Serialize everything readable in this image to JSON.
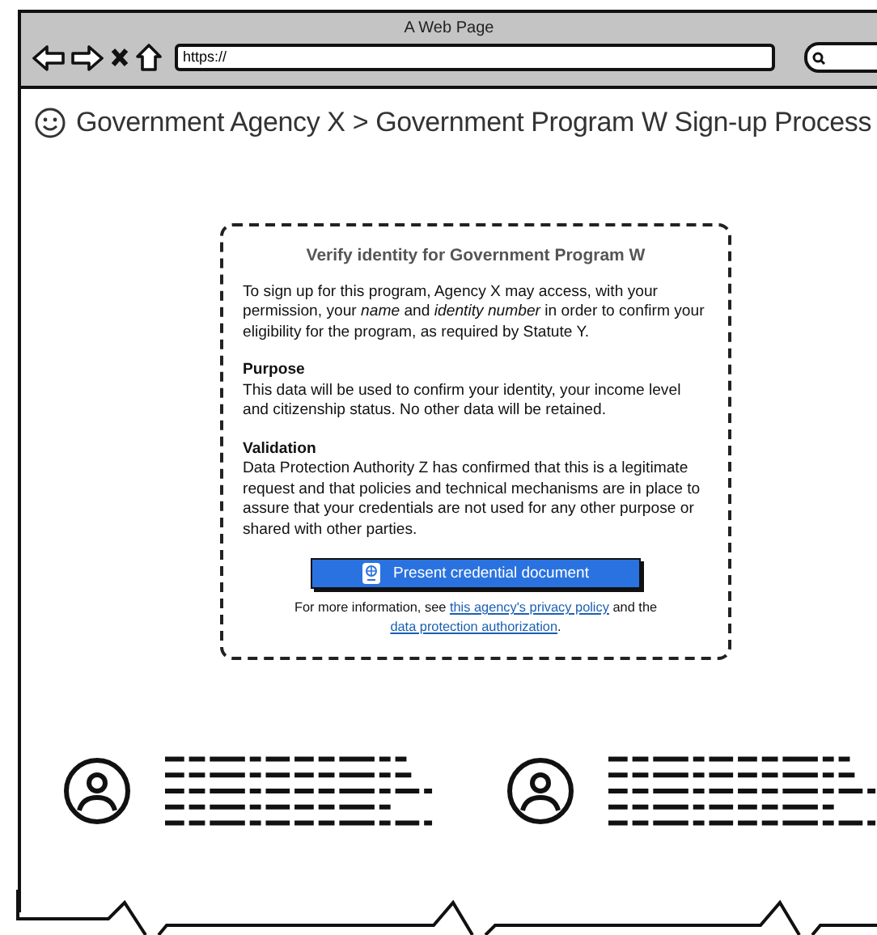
{
  "window": {
    "title": "A Web Page"
  },
  "address_bar": {
    "value": "https://"
  },
  "page_title": "Government Agency X > Government Program W Sign-up Process",
  "card": {
    "heading": "Verify identity for Government Program W",
    "intro": "To sign up for this program, Agency X may access, with your permission, your *name* and *identity number* in order to confirm your eligibility for the program, as required by Statute Y.",
    "sections": [
      {
        "heading": "Purpose",
        "text": "This data will be used to confirm your identity, your income level and citizenship status. No other data will be retained."
      },
      {
        "heading": "Validation",
        "text": "Data Protection Authority Z has confirmed that this is a legitimate request and that policies and technical mechanisms are in place to assure that your credentials are not used for any other purpose or shared with other parties."
      }
    ],
    "button": {
      "label": "Present credential document"
    },
    "footer": [
      {
        "kind": "text",
        "text": "For more information, see "
      },
      {
        "kind": "link",
        "text": "this agency's privacy policy"
      },
      {
        "kind": "text",
        "text": " and the "
      },
      {
        "kind": "link",
        "text": "data protection authorization"
      },
      {
        "kind": "text",
        "text": "."
      }
    ]
  }
}
